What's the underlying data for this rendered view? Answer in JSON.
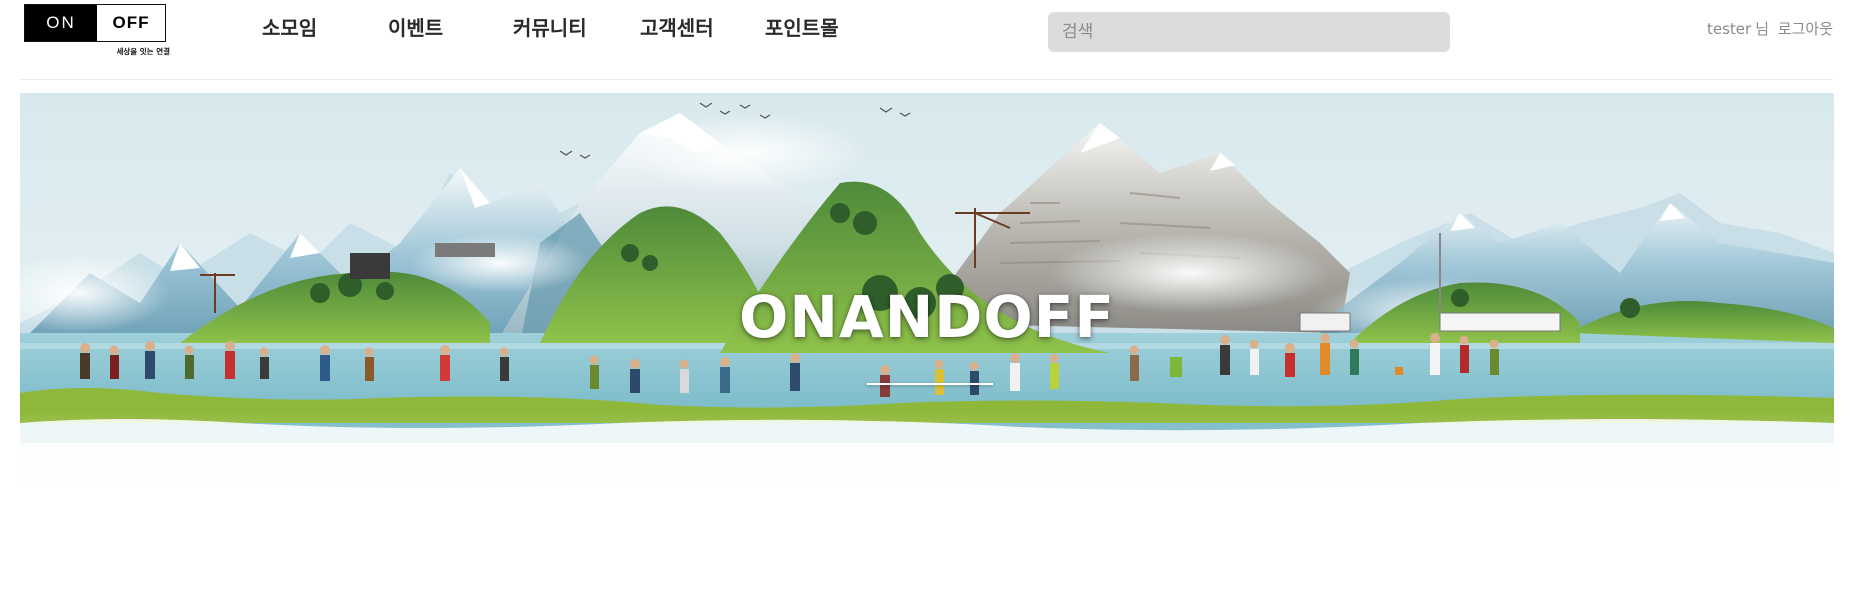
{
  "header": {
    "logo": {
      "on": "ON",
      "off": "OFF",
      "tagline": "세상을 잇는 연결"
    },
    "nav": [
      {
        "label": "소모임"
      },
      {
        "label": "이벤트"
      },
      {
        "label": "커뮤니티"
      },
      {
        "label": "고객센터"
      },
      {
        "label": "포인트몰"
      }
    ],
    "search": {
      "placeholder": "검색",
      "value": ""
    },
    "user": {
      "name": "tester",
      "suffix": "님",
      "logout": "로그아웃"
    }
  },
  "hero": {
    "title": "ONANDOFF",
    "image": "panorama of snowy mountains, green islands and a lake with many miniature hikers along the shore"
  },
  "colors": {
    "logo_on_bg": "#000000",
    "search_bg": "#dcdcdc",
    "user_text": "#8a8a8a",
    "sky": "#dfeef2",
    "lake": "#8fc9d4",
    "grass": "#8fb83a"
  }
}
